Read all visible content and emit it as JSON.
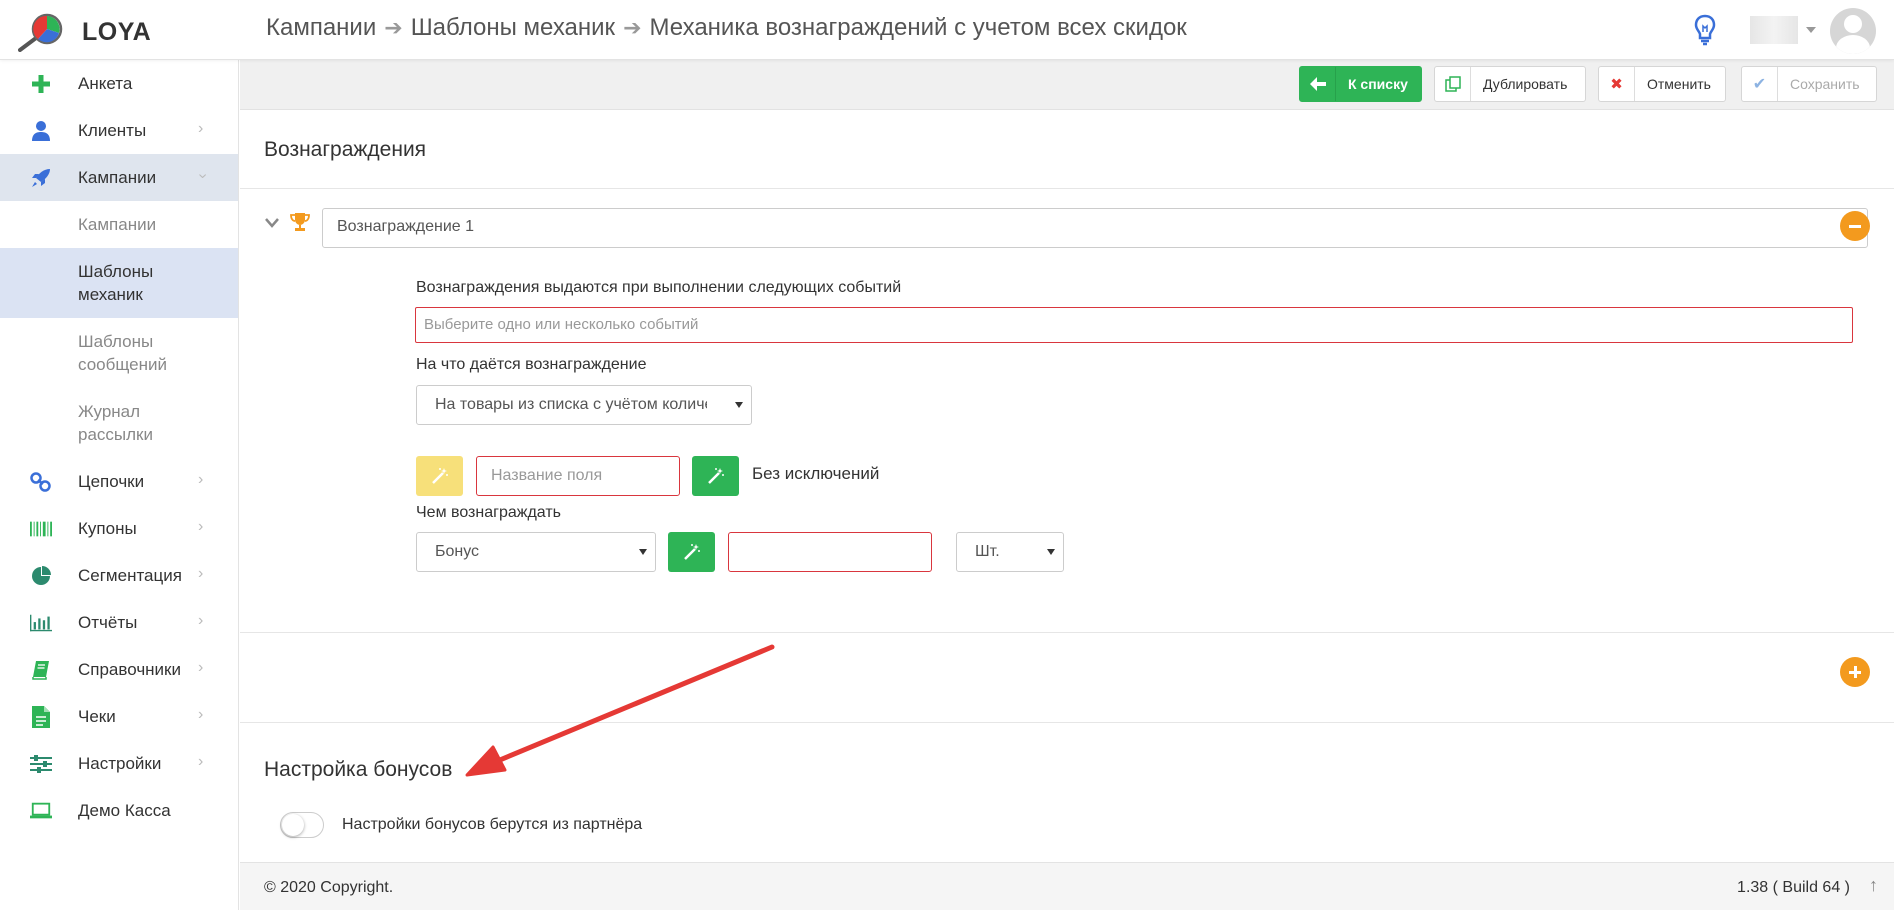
{
  "app": {
    "name": "LOYA"
  },
  "breadcrumb": [
    "Кампании",
    "Шаблоны механик",
    "Механика вознаграждений с учетом всех скидок"
  ],
  "sidebar": {
    "items": [
      {
        "label": "Анкета",
        "icon": "plus-icon"
      },
      {
        "label": "Клиенты",
        "icon": "user-icon"
      },
      {
        "label": "Кампании",
        "icon": "rocket-icon",
        "active": true
      },
      {
        "label": "Цепочки",
        "icon": "link-icon"
      },
      {
        "label": "Купоны",
        "icon": "barcode-icon"
      },
      {
        "label": "Сегментация",
        "icon": "pie-chart-icon"
      },
      {
        "label": "Отчёты",
        "icon": "bar-chart-icon"
      },
      {
        "label": "Справочники",
        "icon": "book-icon"
      },
      {
        "label": "Чеки",
        "icon": "receipt-icon"
      },
      {
        "label": "Настройки",
        "icon": "sliders-icon"
      },
      {
        "label": "Демо Касса",
        "icon": "laptop-icon"
      }
    ],
    "sub_items": [
      {
        "label": "Кампании"
      },
      {
        "label": "Шаблоны механик",
        "active": true
      },
      {
        "label": "Шаблоны сообщений"
      },
      {
        "label": "Журнал рассылки"
      }
    ]
  },
  "toolbar": {
    "back_label": "К списку",
    "duplicate_label": "Дублировать",
    "cancel_label": "Отменить",
    "save_label": "Сохранить"
  },
  "rewards": {
    "title": "Вознаграждения",
    "reward_name": "Вознаграждение 1",
    "events_label": "Вознаграждения выдаются при выполнении следующих событий",
    "events_placeholder": "Выберите одно или несколько событий",
    "target_label": "На что даётся вознаграждение",
    "target_value": "На товары из списка с учётом количества",
    "field_name_placeholder": "Название поля",
    "exceptions_text": "Без исключений",
    "reward_with_label": "Чем вознаграждать",
    "reward_type_value": "Бонус",
    "unit_value": "Шт."
  },
  "bonus_settings": {
    "title": "Настройка бонусов",
    "toggle_label": "Настройки бонусов берутся из партнёра",
    "toggle_on": false
  },
  "footer": {
    "copyright": "© 2020 Copyright.",
    "version": "1.38 ( Build 64 )"
  },
  "colors": {
    "green": "#2eb456",
    "orange": "#f39a1e",
    "error_red": "#d9363e",
    "active_bg": "#dfe5ee",
    "annotation_red": "#e53935"
  }
}
